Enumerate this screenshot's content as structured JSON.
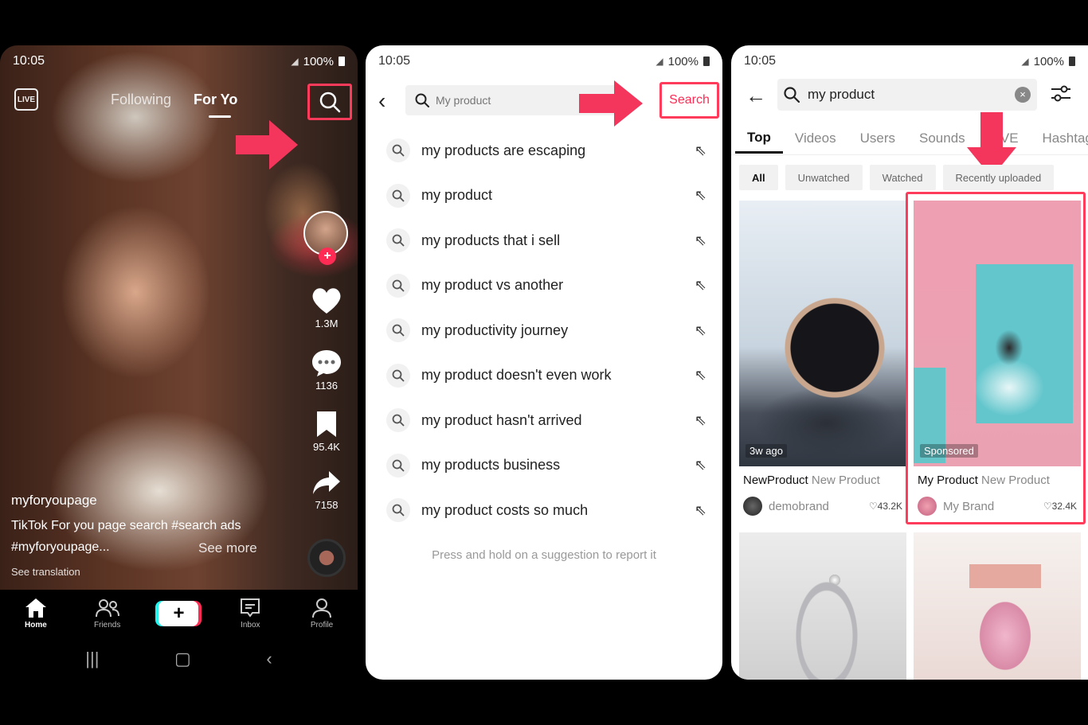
{
  "status": {
    "time": "10:05",
    "battery": "100%"
  },
  "phone1": {
    "live_label": "LIVE",
    "tab_following": "Following",
    "tab_foryou": "For Yo",
    "likes": "1.3M",
    "comments": "1136",
    "saves": "95.4K",
    "shares": "7158",
    "username": "myforyoupage",
    "caption": "TikTok For you page search #search ads",
    "caption_tag": "#myforyoupage...",
    "see_more": "See more",
    "see_translation": "See translation",
    "nav": {
      "home": "Home",
      "friends": "Friends",
      "inbox": "Inbox",
      "profile": "Profile",
      "create": "+"
    }
  },
  "phone2": {
    "search_placeholder": "My product",
    "search_button": "Search",
    "suggestions": [
      "my products are escaping",
      "my product",
      "my products that i sell",
      "my product vs another",
      "my productivity journey",
      "my product doesn't even work",
      "my product hasn't arrived",
      "my products business",
      "my product costs so much"
    ],
    "report_hint": "Press and hold on a suggestion to report it"
  },
  "phone3": {
    "search_value": "my product",
    "tabs": [
      "Top",
      "Videos",
      "Users",
      "Sounds",
      "LIVE",
      "Hashtags"
    ],
    "chips": [
      "All",
      "Unwatched",
      "Watched",
      "Recently uploaded"
    ],
    "cards": [
      {
        "tag": "3w ago",
        "title": "NewProduct",
        "subtitle": "New Product",
        "author": "demobrand",
        "likes": "43.2K"
      },
      {
        "tag": "Sponsored",
        "title": "My Product",
        "subtitle": "New Product",
        "author": "My Brand",
        "likes": "32.4K"
      }
    ]
  },
  "colors": {
    "accent": "#fe2c55",
    "highlight": "#ff3b5c"
  }
}
